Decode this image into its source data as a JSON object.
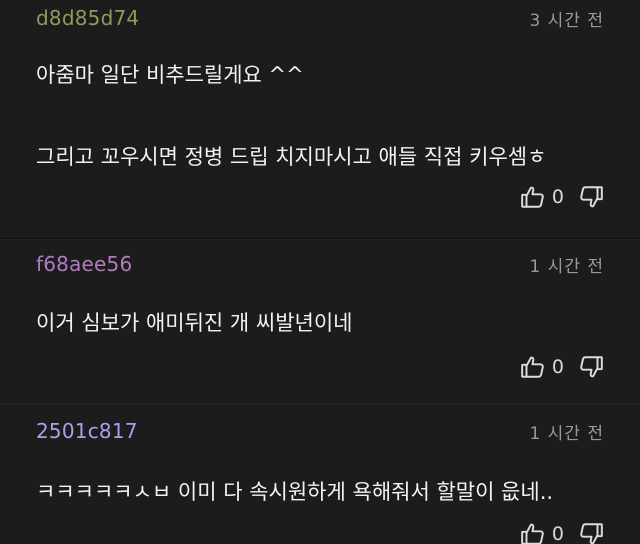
{
  "comments": [
    {
      "author": "d8d85d74",
      "author_color": "#8f9a5a",
      "time": "3 시간 전",
      "lines": [
        "아줌마 일단 비추드릴게요 ^^",
        "그리고 꼬우시면 정병 드립 치지마시고 애들 직접 키우셈ㅎ"
      ],
      "likes": "0"
    },
    {
      "author": "f68aee56",
      "author_color": "#b07cc0",
      "time": "1 시간 전",
      "lines": [
        "이거 심보가 애미뒤진 개 씨발년이네"
      ],
      "likes": "0"
    },
    {
      "author": "2501c817",
      "author_color": "#a9a0e8",
      "time": "1 시간 전",
      "lines": [
        "ㅋㅋㅋㅋㅋㅅㅂ 이미 다 속시원하게 욕해줘서 할말이 읎네.."
      ],
      "likes": "0"
    }
  ],
  "icons": {
    "like": "thumbs-up-icon",
    "dislike": "thumbs-down-icon"
  }
}
